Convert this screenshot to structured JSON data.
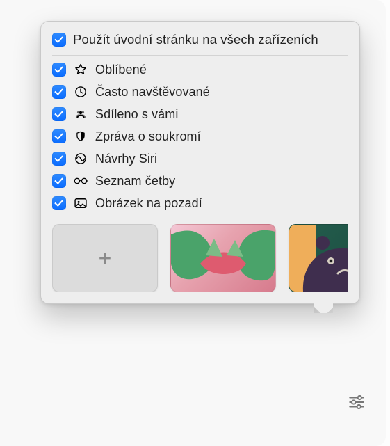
{
  "header": {
    "label": "Použít úvodní stránku na všech zařízeních",
    "checked": true
  },
  "items": [
    {
      "id": "favorites",
      "icon": "star-icon",
      "label": "Oblíbené",
      "checked": true
    },
    {
      "id": "frequently",
      "icon": "clock-icon",
      "label": "Často navštěvované",
      "checked": true
    },
    {
      "id": "shared-with-you",
      "icon": "people-icon",
      "label": "Sdíleno s vámi",
      "checked": true
    },
    {
      "id": "privacy-report",
      "icon": "shield-icon",
      "label": "Zpráva o soukromí",
      "checked": true
    },
    {
      "id": "siri-suggestions",
      "icon": "siri-icon",
      "label": "Návrhy Siri",
      "checked": true
    },
    {
      "id": "reading-list",
      "icon": "glasses-icon",
      "label": "Seznam četby",
      "checked": true
    },
    {
      "id": "background-image",
      "icon": "image-icon",
      "label": "Obrázek na pozadí",
      "checked": true
    }
  ],
  "thumbnails": {
    "add_label": "+"
  },
  "settings_button": "settings"
}
